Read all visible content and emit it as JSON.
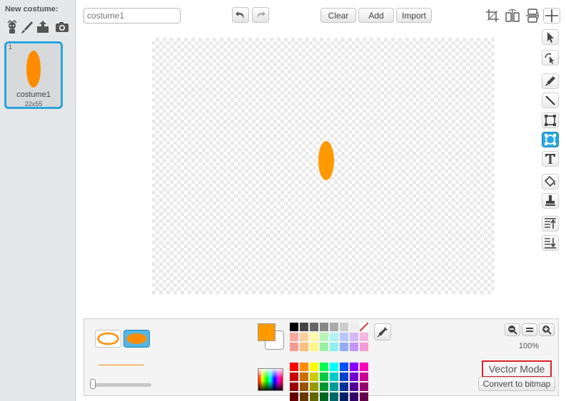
{
  "left_panel": {
    "new_costume_label": "New costume:",
    "new_costume_icons": [
      "character-library-icon",
      "paint-brush-icon",
      "upload-icon",
      "camera-icon"
    ],
    "costumes": [
      {
        "index": "1",
        "name": "costume1",
        "size": "22x55",
        "fill_color": "#ff8c00",
        "selected": true
      }
    ]
  },
  "editor": {
    "costume_name_input": {
      "value": "",
      "placeholder": "costume1"
    },
    "undo_icon": "undo-icon",
    "redo_icon": "redo-icon",
    "clear_label": "Clear",
    "add_label": "Add",
    "import_label": "Import",
    "top_right_icons": [
      "crop-icon",
      "flip-horizontal-icon",
      "flip-vertical-icon",
      "set-center-icon"
    ],
    "canvas": {
      "shape": "ellipse",
      "fill_color": "#ff9900"
    }
  },
  "tools": [
    {
      "name": "select-tool",
      "icon": "arrow-icon",
      "selected": false
    },
    {
      "name": "reshape-tool",
      "icon": "reshape-icon",
      "selected": false
    },
    {
      "name": "pencil-tool",
      "icon": "pencil-icon",
      "selected": false
    },
    {
      "name": "line-tool",
      "icon": "line-icon",
      "selected": false
    },
    {
      "name": "rectangle-tool",
      "icon": "rectangle-icon",
      "selected": false
    },
    {
      "name": "ellipse-tool",
      "icon": "ellipse-icon",
      "selected": true
    },
    {
      "name": "text-tool",
      "icon": "text-icon",
      "selected": false
    },
    {
      "name": "fill-tool",
      "icon": "paint-bucket-icon",
      "selected": false
    },
    {
      "name": "duplicate-tool",
      "icon": "stamp-icon",
      "selected": false
    },
    {
      "name": "forward-layer-tool",
      "icon": "bring-forward-icon",
      "selected": false
    },
    {
      "name": "back-layer-tool",
      "icon": "send-back-icon",
      "selected": false
    }
  ],
  "bottom_panel": {
    "fill_modes": [
      "outlined-ellipse-icon",
      "solid-ellipse-icon"
    ],
    "selected_fill_mode": "solid",
    "line_color": "#ff8c00",
    "primary_color": "#ff9900",
    "secondary_color": "#ffffff",
    "palette_rows": [
      [
        "#000000",
        "#444444",
        "#666666",
        "#888888",
        "#aaaaaa",
        "#cccccc",
        "#eeeeee",
        "#ffffff"
      ],
      [
        "#f8a9a4",
        "#fbcf9d",
        "#fffaa8",
        "#b6f5b6",
        "#b3f3f3",
        "#b8c8f8",
        "#d3b8f8",
        "#f8b8e0"
      ],
      [
        "#f49a95",
        "#f8bf7d",
        "#fff787",
        "#99efa3",
        "#8ff0ee",
        "#93abf5",
        "#c195f5",
        "#f59bd6"
      ],
      [
        "#ff0000",
        "#ff8c00",
        "#ffff00",
        "#00ff4f",
        "#00ffff",
        "#0051ff",
        "#8800ff",
        "#ff00bb"
      ],
      [
        "#cc0000",
        "#cc7000",
        "#cccc00",
        "#00cc3f",
        "#00cccc",
        "#0041cc",
        "#6d00cc",
        "#cc0096"
      ],
      [
        "#990000",
        "#995400",
        "#999900",
        "#00992f",
        "#009999",
        "#003099",
        "#520099",
        "#990070"
      ],
      [
        "#660000",
        "#663800",
        "#666600",
        "#006620",
        "#006666",
        "#002066",
        "#360066",
        "#66004b"
      ]
    ],
    "eyedropper_icon": "eyedropper-icon",
    "zoom_out_icon": "zoom-out-icon",
    "zoom_reset_icon": "zoom-reset-icon",
    "zoom_in_icon": "zoom-in-icon",
    "zoom_level": "100%",
    "mode_label": "Vector Mode",
    "convert_label": "Convert to bitmap"
  }
}
